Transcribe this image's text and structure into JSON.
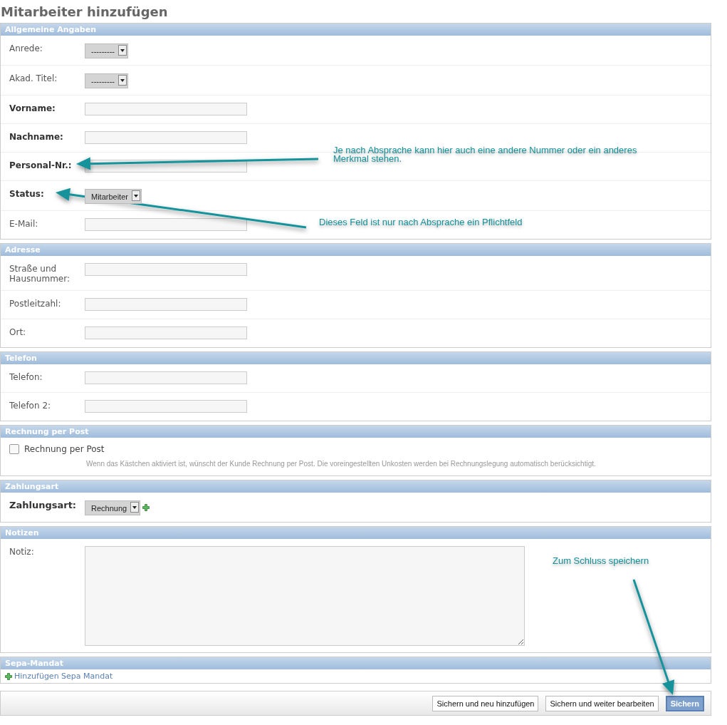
{
  "title": "Mitarbeiter hinzufügen",
  "sections": [
    {
      "title": "Allgemeine Angaben",
      "rows": [
        {
          "kind": "select",
          "label": "Anrede:",
          "required": false,
          "value": "---------"
        },
        {
          "kind": "select",
          "label": "Akad. Titel:",
          "required": false,
          "value": "---------"
        },
        {
          "kind": "text",
          "label": "Vorname:",
          "required": true
        },
        {
          "kind": "text",
          "label": "Nachname:",
          "required": true
        },
        {
          "kind": "text",
          "label": "Personal-Nr.:",
          "required": true
        },
        {
          "kind": "select",
          "label": "Status:",
          "required": true,
          "value": "Mitarbeiter"
        },
        {
          "kind": "text",
          "label": "E-Mail:",
          "required": false
        }
      ]
    },
    {
      "title": "Adresse",
      "rows": [
        {
          "kind": "text",
          "label": "Straße und Hausnummer:",
          "required": false
        },
        {
          "kind": "text",
          "label": "Postleitzahl:",
          "required": false
        },
        {
          "kind": "text",
          "label": "Ort:",
          "required": false
        }
      ]
    },
    {
      "title": "Telefon",
      "rows": [
        {
          "kind": "text",
          "label": "Telefon:",
          "required": false
        },
        {
          "kind": "text",
          "label": "Telefon 2:",
          "required": false
        }
      ]
    },
    {
      "title": "Rechnung per Post",
      "rows": [
        {
          "kind": "checkbox",
          "label": "Rechnung per Post",
          "required": false,
          "checked": false,
          "help": "Wenn das Kästchen aktiviert ist, wünscht der Kunde Rechnung per Post. Die voreingestellten Unkosten werden bei Rechnungslegung automatisch berücksichtigt."
        }
      ]
    },
    {
      "title": "Zahlungsart",
      "rows": [
        {
          "kind": "select",
          "label": "Zahlungsart:",
          "required": true,
          "value": "Rechnung",
          "addable": true
        }
      ]
    },
    {
      "title": "Notizen",
      "rows": [
        {
          "kind": "textarea",
          "label": "Notiz:",
          "required": false
        }
      ]
    }
  ],
  "inline": {
    "title": "Sepa-Mandat",
    "add_link": "Hinzufügen Sepa Mandat"
  },
  "buttons": [
    {
      "label": "Sichern und neu hinzufügen",
      "default": false
    },
    {
      "label": "Sichern und weiter bearbeiten",
      "default": false
    },
    {
      "label": "Sichern",
      "default": true
    }
  ],
  "annotations": [
    {
      "text": "Je nach Absprache kann hier auch eine andere Nummer oder ein anderes Merkmal stehen."
    },
    {
      "text": "Dieses Feld ist nur nach Absprache ein Pflichtfeld"
    },
    {
      "text": "Zum Schluss speichern"
    }
  ]
}
